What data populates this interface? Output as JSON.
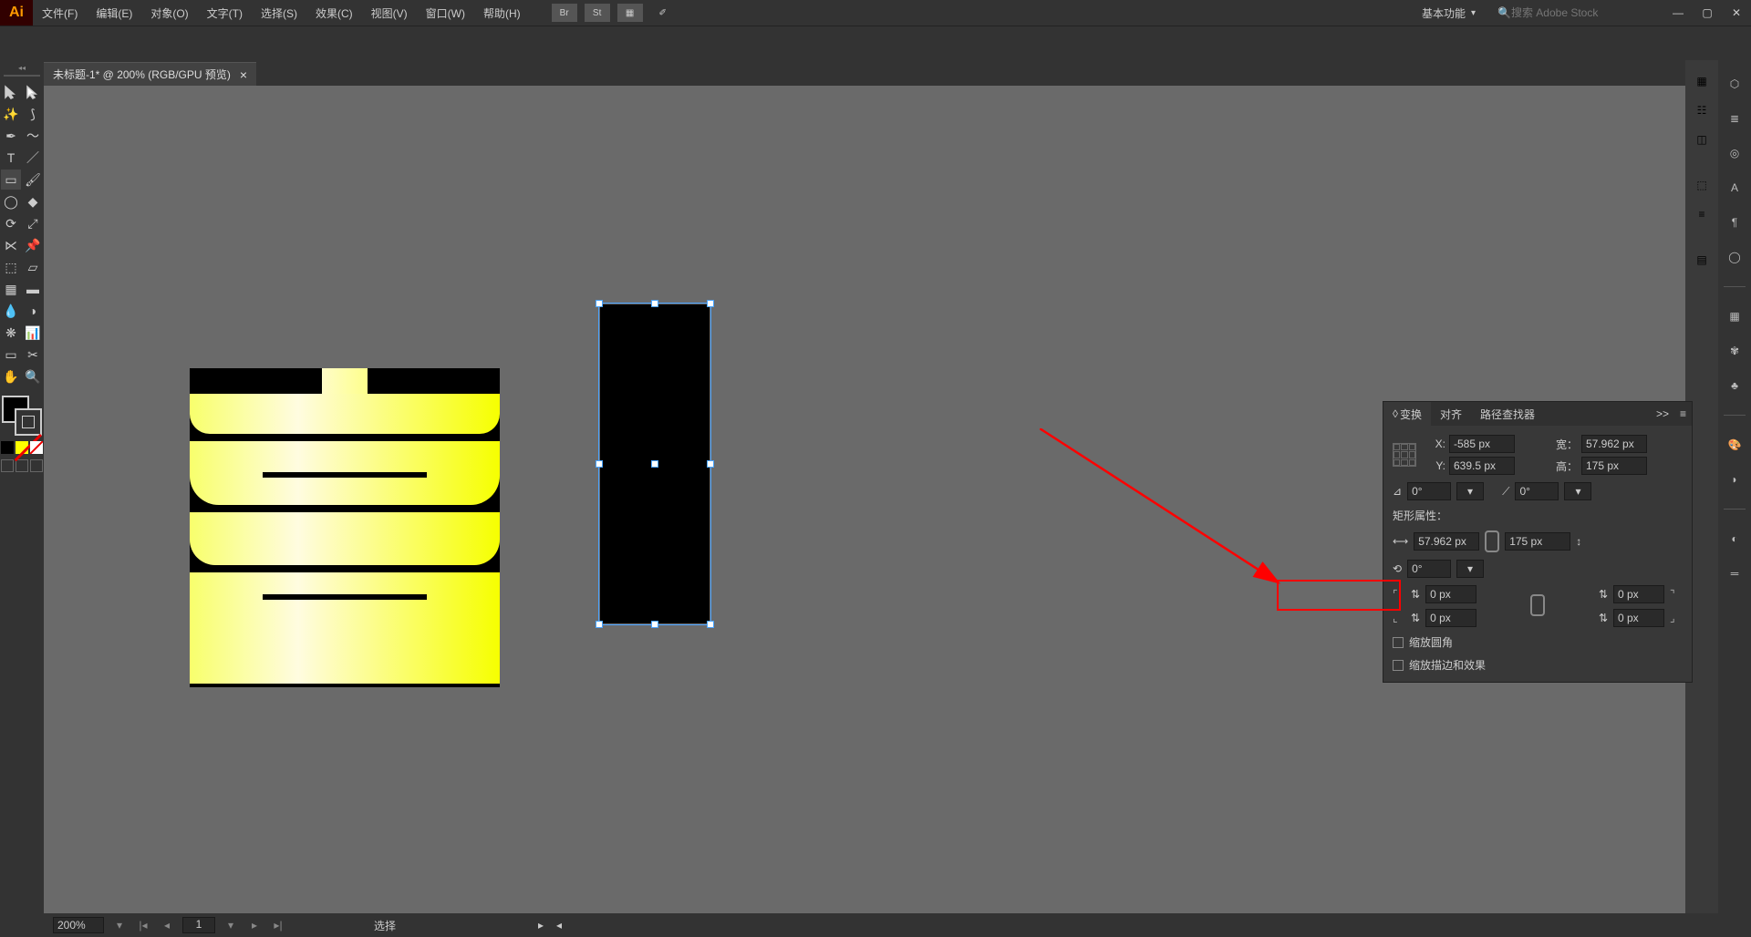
{
  "app": {
    "logo": "Ai"
  },
  "menu": {
    "file": "文件(F)",
    "edit": "编辑(E)",
    "object": "对象(O)",
    "type": "文字(T)",
    "select": "选择(S)",
    "effect": "效果(C)",
    "view": "视图(V)",
    "window": "窗口(W)",
    "help": "帮助(H)"
  },
  "topbar": {
    "workspace_label": "基本功能",
    "icon_br": "Br",
    "icon_st": "St",
    "search_placeholder": "搜索 Adobe Stock"
  },
  "doc": {
    "tab_title": "未标题-1* @ 200% (RGB/GPU 预览)"
  },
  "transform_panel": {
    "tab_transform": "变换",
    "tab_align": "对齐",
    "tab_pathfinder": "路径查找器",
    "more": ">>",
    "x_label": "X:",
    "y_label": "Y:",
    "w_label": "宽：",
    "h_label": "高：",
    "x_value": "-585 px",
    "y_value": "639.5 px",
    "w_value": "57.962 px",
    "h_value": "175 px",
    "rotate_value": "0°",
    "shear_value": "0°",
    "rect_attrs_label": "矩形属性：",
    "rect_w": "57.962 px",
    "rect_h": "175 px",
    "rotate2": "0°",
    "corner_radius": "0 px",
    "scale_corners": "缩放圆角",
    "scale_strokes": "缩放描边和效果"
  },
  "status": {
    "zoom": "200%",
    "page": "1",
    "tool": "选择"
  },
  "colors": {
    "accent": "#ff9a00",
    "selection": "#4aa3ff",
    "annotation": "#ff0000"
  }
}
